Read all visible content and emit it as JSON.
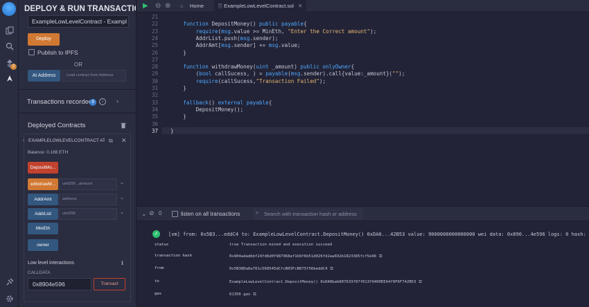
{
  "rail": {
    "icons": [
      "remix-logo-icon",
      "file-explorer-icon",
      "search-icon",
      "solidity-compiler-icon",
      "deploy-run-icon",
      "plugin-manager-icon",
      "settings-icon"
    ],
    "compiler_badge": "2"
  },
  "panel": {
    "title": "DEPLOY & RUN TRANSACTIONS",
    "contract_select": "ExampleLowLevelContract - Exampl",
    "deploy_label": "Deploy",
    "publish_ipfs_label": "Publish to IPFS",
    "or_label": "OR",
    "at_address_label": "At Address",
    "at_address_placeholder": "Load contract from Address",
    "transactions_recorded_label": "Transactions recorded",
    "transactions_recorded_count": "9",
    "deployed_contracts_label": "Deployed Contracts",
    "instance": {
      "name": "EXAMPLELOWLEVELCONTRACT AT 0x",
      "balance": "Balance: 0.188 ETH",
      "functions": [
        {
          "label": "DepositMo...",
          "color": "red",
          "has_input": false
        },
        {
          "label": "withdrawM...",
          "color": "orange",
          "has_input": true,
          "placeholder": "uint256 _amount"
        },
        {
          "label": "AddrAmt",
          "color": "blue",
          "has_input": true,
          "placeholder": "address"
        },
        {
          "label": "AddrList",
          "color": "blue",
          "has_input": true,
          "placeholder": "uint256"
        },
        {
          "label": "MinEth",
          "color": "blue",
          "has_input": false
        },
        {
          "label": "owner",
          "color": "blue",
          "has_input": false
        }
      ]
    },
    "low_level_label": "Low level interactions",
    "calldata_label": "CALLDATA",
    "calldata_value": "0x8904e596",
    "transact_label": "Transact"
  },
  "tabs": {
    "home_label": "Home",
    "file_label": "ExampleLowLevelContract.sol"
  },
  "editor": {
    "lines": [
      {
        "n": "21",
        "code": ""
      },
      {
        "n": "22",
        "code": "    function DepositMoney() public payable{"
      },
      {
        "n": "23",
        "code": "        require(msg.value >= MinEth, \"Enter the Correct amount\");"
      },
      {
        "n": "24",
        "code": "        AddrList.push(msg.sender);"
      },
      {
        "n": "25",
        "code": "        AddrAmt[msg.sender] += msg.value;"
      },
      {
        "n": "26",
        "code": "    }"
      },
      {
        "n": "27",
        "code": ""
      },
      {
        "n": "28",
        "code": "    function withdrawMoney(uint _amount) public onlyOwner{"
      },
      {
        "n": "29",
        "code": "        (bool callSucess, ) = payable(msg.sender).call{value:_amount}(\"\");"
      },
      {
        "n": "30",
        "code": "        require(callSucess,\"Transaction Failed\");"
      },
      {
        "n": "31",
        "code": "    }"
      },
      {
        "n": "32",
        "code": ""
      },
      {
        "n": "33",
        "code": "    fallback() external payable{"
      },
      {
        "n": "34",
        "code": "        DepositMoney();"
      },
      {
        "n": "35",
        "code": "    }"
      },
      {
        "n": "36",
        "code": ""
      },
      {
        "n": "37",
        "code": "}"
      }
    ]
  },
  "terminal": {
    "pending_count": "0",
    "listen_label": "listen on all transactions",
    "search_placeholder": "Search with transaction hash or address",
    "summary": "[vm] from: 0x5B3...eddC4 to: ExampleLowLevelContract.DepositMoney() 0xDA0...42B53 value: 9000000000000000 wei data: 0x890...4e596 logs: 0 hash: 0x904...c5e96",
    "details": [
      {
        "key": "status",
        "value": "true Transaction mined and execution succeed",
        "copy": false
      },
      {
        "key": "transaction hash",
        "value": "0x904adadbbf24fd6d0f987968af1b9f6b51d026fd2aa692b1823385fcf5e96",
        "copy": true
      },
      {
        "key": "from",
        "value": "0x5B38Da6a701c568545dCfcB03FcB875f56beddC4",
        "copy": true
      },
      {
        "key": "to",
        "value": "ExampleLowLevelContract.DepositMoney() 0xDA0bab807633f07f013f9400EEA4f9F6F742B53",
        "copy": true
      },
      {
        "key": "gas",
        "value": "61356 gas",
        "copy": true
      }
    ]
  }
}
